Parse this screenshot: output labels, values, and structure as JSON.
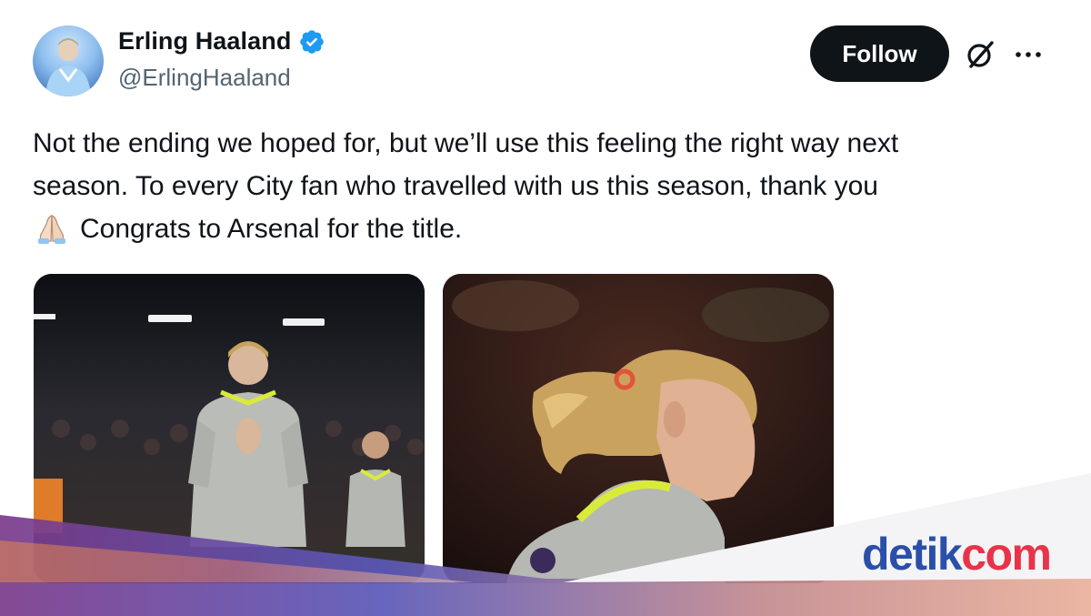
{
  "author": {
    "display_name": "Erling Haaland",
    "handle": "@ErlingHaaland",
    "verified": true
  },
  "actions": {
    "follow_label": "Follow",
    "grok_icon": "grok-icon",
    "more_icon": "more-options-icon"
  },
  "tweet": {
    "lines": [
      "Not the ending we hoped for, but we’ll use this feeling the right way next",
      "season. To every City fan who travelled with us this season, thank you",
      "Congrats to Arsenal for the title."
    ],
    "emoji": "praying-hands"
  },
  "media": [
    {
      "icon": "photo-haaland-applauding"
    },
    {
      "icon": "photo-haaland-profile"
    }
  ],
  "watermark": {
    "text_main": "detik",
    "text_accent": "com"
  },
  "colors": {
    "text": "#0f1419",
    "secondary": "#536471",
    "verified": "#1d9bf0",
    "follow_bg": "#0f1419",
    "watermark_blue": "#2a4fa8"
  }
}
